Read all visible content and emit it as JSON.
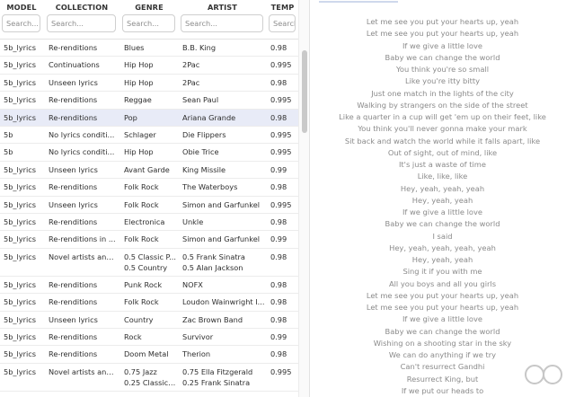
{
  "columns": [
    {
      "key": "model",
      "label": "MODEL",
      "placeholder": "Search..."
    },
    {
      "key": "collection",
      "label": "COLLECTION",
      "placeholder": "Search..."
    },
    {
      "key": "genre",
      "label": "GENRE",
      "placeholder": "Search..."
    },
    {
      "key": "artist",
      "label": "ARTIST",
      "placeholder": "Search..."
    },
    {
      "key": "temp",
      "label": "TEMP",
      "placeholder": "Search..."
    }
  ],
  "rows": [
    {
      "model": "5b_lyrics",
      "collection": "Re-renditions",
      "genre": [
        "Blues"
      ],
      "artist": [
        "B.B. King"
      ],
      "temp": "0.98"
    },
    {
      "model": "5b_lyrics",
      "collection": "Continuations",
      "genre": [
        "Hip Hop"
      ],
      "artist": [
        "2Pac"
      ],
      "temp": "0.995"
    },
    {
      "model": "5b_lyrics",
      "collection": "Unseen lyrics",
      "genre": [
        "Hip Hop"
      ],
      "artist": [
        "2Pac"
      ],
      "temp": "0.98"
    },
    {
      "model": "5b_lyrics",
      "collection": "Re-renditions",
      "genre": [
        "Reggae"
      ],
      "artist": [
        "Sean Paul"
      ],
      "temp": "0.995"
    },
    {
      "model": "5b_lyrics",
      "collection": "Re-renditions",
      "genre": [
        "Pop"
      ],
      "artist": [
        "Ariana Grande"
      ],
      "temp": "0.98",
      "selected": true
    },
    {
      "model": "5b",
      "collection": "No lyrics conditi...",
      "genre": [
        "Schlager"
      ],
      "artist": [
        "Die Flippers"
      ],
      "temp": "0.995"
    },
    {
      "model": "5b",
      "collection": "No lyrics conditi...",
      "genre": [
        "Hip Hop"
      ],
      "artist": [
        "Obie Trice"
      ],
      "temp": "0.995"
    },
    {
      "model": "5b_lyrics",
      "collection": "Unseen lyrics",
      "genre": [
        "Avant Garde"
      ],
      "artist": [
        "King Missile"
      ],
      "temp": "0.99"
    },
    {
      "model": "5b_lyrics",
      "collection": "Re-renditions",
      "genre": [
        "Folk Rock"
      ],
      "artist": [
        "The Waterboys"
      ],
      "temp": "0.98"
    },
    {
      "model": "5b_lyrics",
      "collection": "Unseen lyrics",
      "genre": [
        "Folk Rock"
      ],
      "artist": [
        "Simon and Garfunkel"
      ],
      "temp": "0.995"
    },
    {
      "model": "5b_lyrics",
      "collection": "Re-renditions",
      "genre": [
        "Electronica"
      ],
      "artist": [
        "Unkle"
      ],
      "temp": "0.98"
    },
    {
      "model": "5b_lyrics",
      "collection": "Re-renditions in ...",
      "genre": [
        "Folk Rock"
      ],
      "artist": [
        "Simon and Garfunkel"
      ],
      "temp": "0.99"
    },
    {
      "model": "5b_lyrics",
      "collection": "Novel artists and...",
      "genre": [
        "0.5 Classic P...",
        "0.5 Country"
      ],
      "artist": [
        "0.5 Frank Sinatra",
        "0.5 Alan Jackson"
      ],
      "temp": "0.98"
    },
    {
      "model": "5b_lyrics",
      "collection": "Re-renditions",
      "genre": [
        "Punk Rock"
      ],
      "artist": [
        "NOFX"
      ],
      "temp": "0.98"
    },
    {
      "model": "5b_lyrics",
      "collection": "Re-renditions",
      "genre": [
        "Folk Rock"
      ],
      "artist": [
        "Loudon Wainwright I..."
      ],
      "temp": "0.98"
    },
    {
      "model": "5b_lyrics",
      "collection": "Unseen lyrics",
      "genre": [
        "Country"
      ],
      "artist": [
        "Zac Brown Band"
      ],
      "temp": "0.98"
    },
    {
      "model": "5b_lyrics",
      "collection": "Re-renditions",
      "genre": [
        "Rock"
      ],
      "artist": [
        "Survivor"
      ],
      "temp": "0.99"
    },
    {
      "model": "5b_lyrics",
      "collection": "Re-renditions",
      "genre": [
        "Doom Metal"
      ],
      "artist": [
        "Therion"
      ],
      "temp": "0.98"
    },
    {
      "model": "5b_lyrics",
      "collection": "Novel artists and...",
      "genre": [
        "0.75 Jazz",
        "0.25 Classic ..."
      ],
      "artist": [
        "0.75 Ella Fitzgerald",
        "0.25 Frank Sinatra"
      ],
      "temp": "0.995"
    }
  ],
  "lyrics": [
    "Let me see you put your hearts up, yeah",
    "Let me see you put your hearts up, yeah",
    "If we give a little love",
    "Baby we can change the world",
    "You think you're so small",
    "Like you're itty bitty",
    "Just one match in the lights of the city",
    "Walking by strangers on the side of the street",
    "Like a quarter in a cup will get 'em up on their feet, like",
    "You think you'll never gonna make your mark",
    "Sit back and watch the world while it falls apart, like",
    "Out of sight, out of mind, like",
    "It's just a waste of time",
    "Like, like, like",
    "Hey, yeah, yeah, yeah",
    "Hey, yeah, yeah",
    "If we give a little love",
    "Baby we can change the world",
    "I said",
    "Hey, yeah, yeah, yeah, yeah",
    "Hey, yeah, yeah",
    "Sing it if you with me",
    "All you boys and all you girls",
    "Let me see you put your hearts up, yeah",
    "Let me see you put your hearts up, yeah",
    "If we give a little love",
    "Baby we can change the world",
    "Wishing on a shooting star in the sky",
    "We can do anything if we try",
    "Can't resurrect Gandhi",
    "Resurrect King, but",
    "If we put our heads to"
  ],
  "scrollbar": {
    "position_fraction": 0.16
  }
}
